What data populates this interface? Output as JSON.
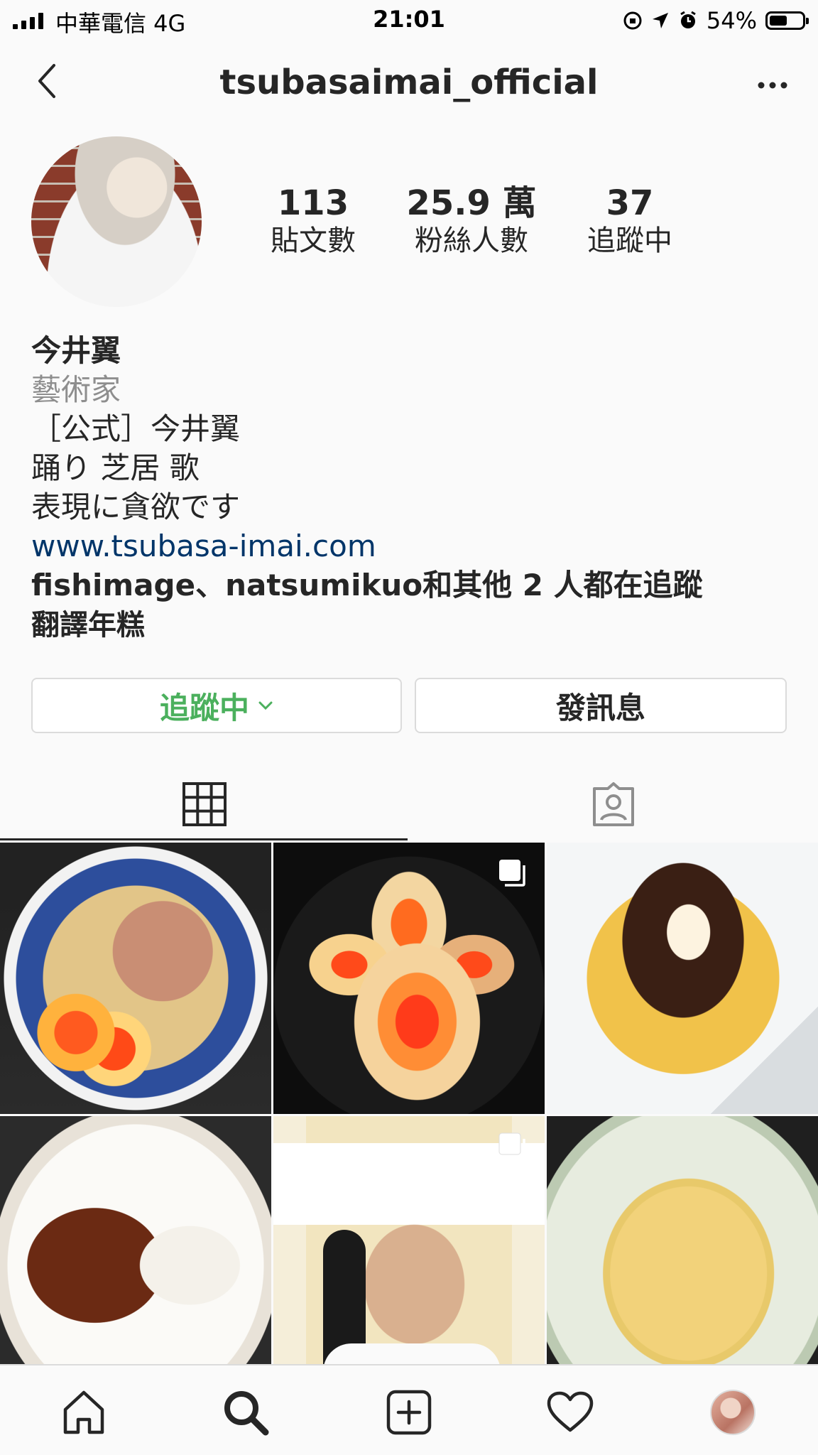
{
  "status_bar": {
    "carrier": "中華電信  4G",
    "time": "21:01",
    "battery": "54%",
    "battery_level": 0.54
  },
  "header": {
    "username": "tsubasaimai_official",
    "back_icon": "chevron-left-icon",
    "more_icon": "more-horizontal-icon"
  },
  "stats": [
    {
      "value": "113",
      "label": "貼文數"
    },
    {
      "value": "25.9 萬",
      "label": "粉絲人數"
    },
    {
      "value": "37",
      "label": "追蹤中"
    }
  ],
  "bio": {
    "name": "今井翼",
    "category": "藝術家",
    "lines": [
      "［公式］今井翼",
      "踊り 芝居 歌",
      "表現に貪欲です"
    ],
    "website": "www.tsubasa-imai.com",
    "followed_by": "fishimage、natsumikuo和其他 2 人都在追蹤",
    "translate": "翻譯年糕"
  },
  "buttons": {
    "following": "追蹤中",
    "message": "發訊息"
  },
  "tabs": {
    "grid_icon": "grid-icon",
    "tagged_icon": "tagged-icon"
  },
  "posts": [
    {
      "subject": "ramen bowl",
      "multi": false
    },
    {
      "subject": "marinated eggs",
      "multi": true
    },
    {
      "subject": "spaghetti with meat sauce",
      "multi": false
    },
    {
      "subject": "curry rice",
      "multi": false
    },
    {
      "subject": "chef portrait",
      "multi": true
    },
    {
      "subject": "fried rice",
      "multi": false
    }
  ],
  "colors": {
    "following_green": "#4bb05d",
    "link_blue": "#003569",
    "secondary_gray": "#8e8e8e"
  },
  "bottom_nav": [
    "home-icon",
    "search-icon",
    "new-post-icon",
    "activity-heart-icon",
    "profile-avatar"
  ]
}
